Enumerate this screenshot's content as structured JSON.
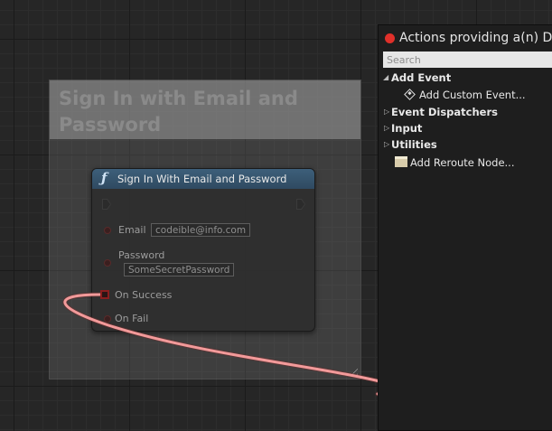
{
  "comment": {
    "title": "Sign In with Email and Password"
  },
  "node": {
    "title": "Sign In With Email and Password",
    "function_icon": "ƒ",
    "pins": {
      "email_label": "Email",
      "email_value": "codeible@info.com",
      "password_label": "Password",
      "password_value": "SomeSecretPassword",
      "on_success_label": "On Success",
      "on_fail_label": "On Fail"
    }
  },
  "actions_menu": {
    "title": "Actions providing a(n) D",
    "search": {
      "placeholder": "Search",
      "value": ""
    },
    "items": [
      {
        "label": "Add Event",
        "kind": "category",
        "expanded": true
      },
      {
        "label": "Add Custom Event...",
        "kind": "action",
        "icon": "event-icon"
      },
      {
        "label": "Event Dispatchers",
        "kind": "category",
        "expanded": false
      },
      {
        "label": "Input",
        "kind": "category",
        "expanded": false
      },
      {
        "label": "Utilities",
        "kind": "category",
        "expanded": false
      },
      {
        "label": "Add Reroute Node...",
        "kind": "action",
        "icon": "reroute-node-icon"
      }
    ]
  },
  "colors": {
    "graph_background": "#262626",
    "node_header": "#3d5f7a",
    "exec_wire": "#f08a8a",
    "close_button": "#e0302a"
  }
}
